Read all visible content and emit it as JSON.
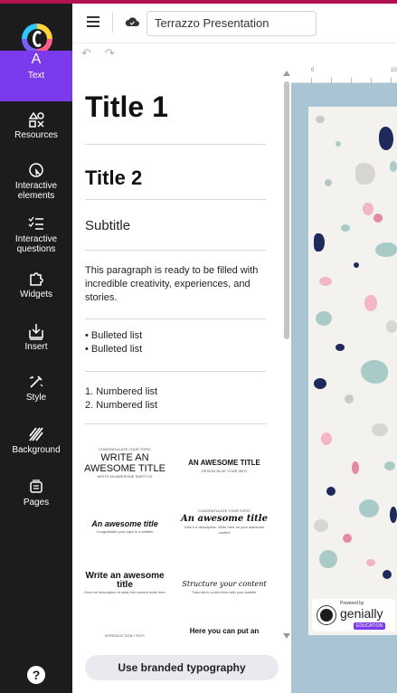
{
  "topbar": {
    "document_title": "Terrazzo Presentation"
  },
  "sidebar": {
    "items": [
      {
        "label": "Text",
        "icon": "text-icon",
        "active": true
      },
      {
        "label": "Resources",
        "icon": "shapes-icon"
      },
      {
        "label": "Interactive elements",
        "icon": "cursor-click-icon"
      },
      {
        "label": "Interactive questions",
        "icon": "checklist-icon"
      },
      {
        "label": "Widgets",
        "icon": "puzzle-icon"
      },
      {
        "label": "Insert",
        "icon": "insert-icon"
      },
      {
        "label": "Style",
        "icon": "wand-icon"
      },
      {
        "label": "Background",
        "icon": "pattern-icon"
      },
      {
        "label": "Pages",
        "icon": "pages-icon"
      }
    ],
    "help_label": "?"
  },
  "panel": {
    "title1": "Title 1",
    "title2": "Title 2",
    "subtitle": "Subtitle",
    "paragraph": "This paragraph is ready to be filled with incredible creativity, experiences, and stories.",
    "bulleted": [
      "Bulleted list",
      "Bulleted list"
    ],
    "numbered": [
      "1. Numbered list",
      "2. Numbered list"
    ],
    "tiles": [
      {
        "top": "CONGRATULATE YOUR TOPIC",
        "main": "WRITE AN AWESOME TITLE",
        "bottom": "WRITE AN AWESOME SUBTITLE"
      },
      {
        "top": "",
        "main": "AN AWESOME TITLE",
        "bottom": "DESIGN BLUE YOUR INFO"
      },
      {
        "top": "",
        "main": "An awesome title",
        "bottom": "Congratulate your topic in a subtitle"
      },
      {
        "top": "CONGRATULATE YOUR TOPIC",
        "main": "An awesome title",
        "bottom": "Give it a description. Write here on your awesome content"
      },
      {
        "top": "",
        "main": "Write an awesome title",
        "bottom": "Give me description of what this content adds here"
      },
      {
        "top": "",
        "main": "Structure your content",
        "bottom": "Take this in a few lines with your subtitle"
      },
      {
        "top": "",
        "main": "INTRODUCTION +TEXT",
        "bottom": ""
      },
      {
        "top": "",
        "main": "Here you can put an",
        "bottom": ""
      }
    ],
    "branded_button": "Use branded typography"
  },
  "ruler": {
    "marks": [
      "0",
      "10"
    ]
  },
  "watermark": {
    "powered": "Powered by",
    "name": "genially",
    "badge": "EDUCATION"
  },
  "colors": {
    "sidebar_bg": "#1c1c1f",
    "active_item": "#7c3aed",
    "canvas_bg": "#a9c5d3",
    "terrazzo_navy": "#1f2a5a",
    "terrazzo_pink": "#f2b6c6",
    "terrazzo_teal": "#a9cbc8",
    "terrazzo_grey": "#c9c9c9"
  }
}
